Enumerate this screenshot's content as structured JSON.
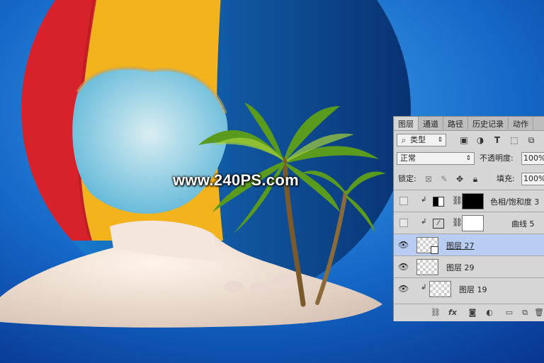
{
  "watermark": "www.240PS.com",
  "colors": {
    "ball_red": "#d8222b",
    "ball_yellow": "#f2b31c",
    "ball_blue": "#0a63b8",
    "bg_blue": "#0e5fc4",
    "panel_bg": "#d6d6d6",
    "selected_row": "#b9cdf3"
  },
  "panel": {
    "tabs": [
      "图层",
      "通道",
      "路径",
      "历史记录",
      "动作"
    ],
    "active_tab": "图层",
    "filter": {
      "label": "类型",
      "icon": "search-icon"
    },
    "blend_mode": "正常",
    "opacity_label": "不透明度:",
    "opacity_value": "100%",
    "lock_label": "锁定:",
    "fill_label": "填充:",
    "fill_value": "100%",
    "layers": [
      {
        "name": "色相/饱和度 3",
        "visible": false,
        "clipped": true
      },
      {
        "name": "曲线 5",
        "visible": false,
        "clipped": true
      },
      {
        "name": "图层 27",
        "visible": true,
        "selected": true
      },
      {
        "name": "图层 29",
        "visible": true
      },
      {
        "name": "图层 19",
        "visible": true,
        "clipped": true
      }
    ]
  }
}
